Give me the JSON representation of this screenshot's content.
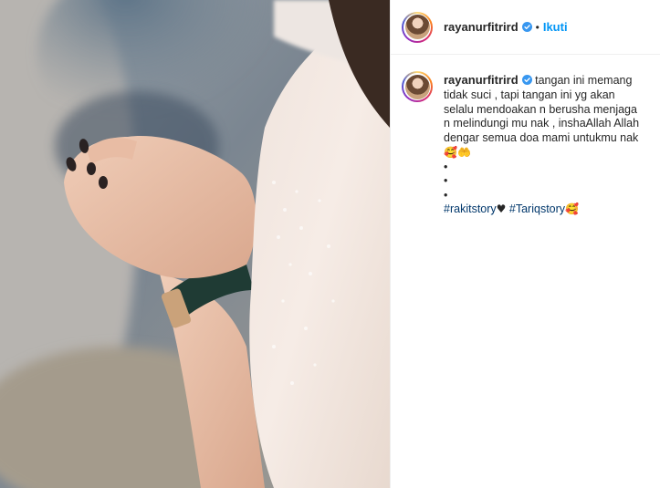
{
  "post": {
    "username": "rayanurfitrird",
    "separator": "•",
    "follow_label": "Ikuti",
    "caption_lines": [
      "tangan ini memang tidak suci , tapi tangan ini yg akan selalu mendoakan n berusha menjaga n melindungi mu nak , inshaAllah Allah dengar semua doa mami untukmu nak"
    ],
    "caption_emoji": "🥰🤲",
    "bullets": [
      "•",
      "•",
      "•"
    ],
    "hashtag_1": "#rakitstory",
    "hashtag_1_suffix": "♥",
    "hashtag_2": "#Tariqstory",
    "hashtag_2_suffix": "🥰"
  },
  "icons": {
    "verified": "verified-badge-icon",
    "avatar": "profile-avatar"
  },
  "colors": {
    "link_blue": "#0095f6",
    "hashtag": "#00376b",
    "verified": "#3897f0",
    "text": "#262626",
    "border": "#efefef"
  }
}
